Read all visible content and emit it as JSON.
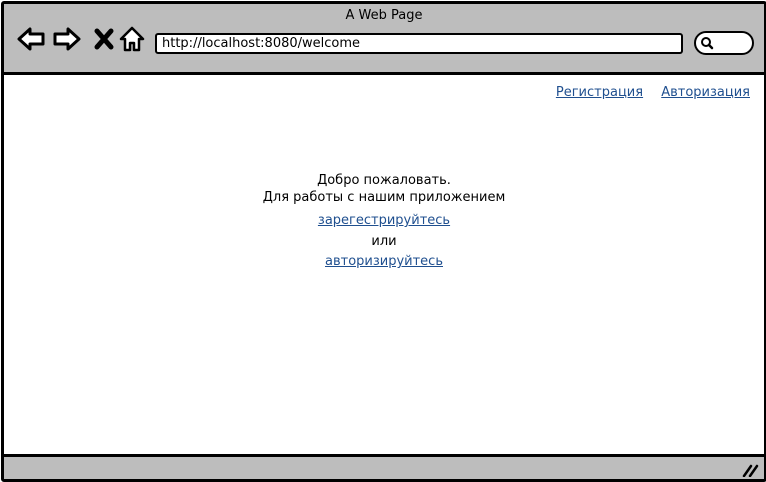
{
  "window": {
    "title": "A Web Page",
    "url": "http://localhost:8080/welcome"
  },
  "toolbar": {
    "back_icon": "back-arrow-icon",
    "forward_icon": "forward-arrow-icon",
    "close_icon": "close-icon",
    "home_icon": "home-icon",
    "search_icon": "search-icon"
  },
  "header_links": {
    "register": "Регистрация",
    "login": "Авторизация"
  },
  "welcome": {
    "greeting": "Добро пожаловать.",
    "prompt": "Для работы с нашим приложением",
    "register_link": "зарегестрируйтесь",
    "or": "или",
    "login_link": "авторизируйтесь"
  },
  "colors": {
    "chrome": "#bdbdbd",
    "link": "#1f4f8f"
  }
}
